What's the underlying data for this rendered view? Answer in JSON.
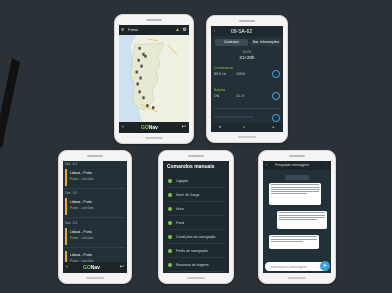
{
  "colors": {
    "background": "#2b3237",
    "app_dark": "#243038",
    "accent_green": "#8bc53f",
    "accent_blue": "#3ea0d8",
    "accent_orange": "#e8a93b"
  },
  "brand": {
    "name_prefix": "GO",
    "name_suffix": "Nav"
  },
  "map_screen": {
    "title": "Portos"
  },
  "boat_screen": {
    "title": "09-SA-62",
    "tabs": [
      "Controlos",
      "Bar. Informações"
    ],
    "readings": {
      "time": "21+20h",
      "ref": "00:00"
    },
    "sections": [
      "Combustível",
      "Bateria"
    ],
    "cells": [
      "89.5 Ltr",
      "100%",
      "ON",
      "3.1 V"
    ]
  },
  "trips_screen": {
    "sections": [
      "Dia: 1/1",
      "Dia: 1/2",
      "Dia: 1/3"
    ],
    "items": [
      {
        "label": "Lisboa - Porto",
        "sub": "Porto - Leixões"
      },
      {
        "label": "Lisboa - Porto",
        "sub": "Porto - Leixões"
      },
      {
        "label": "Lisboa - Porto",
        "sub": "Porto - Leixões"
      },
      {
        "label": "Lisboa - Porto",
        "sub": "Porto - Leixões"
      }
    ]
  },
  "menu_screen": {
    "title": "Comandos manuais",
    "items": [
      "Ligação",
      "Nível de Carga",
      "Hora",
      "Porta",
      "Condições de navegação",
      "Perfis de navegação",
      "Resumos de viagens"
    ]
  },
  "chat_screen": {
    "title": "Pesquisar mensagem",
    "input_placeholder": "Introduza a mensagem",
    "send_icon": "send-icon"
  }
}
